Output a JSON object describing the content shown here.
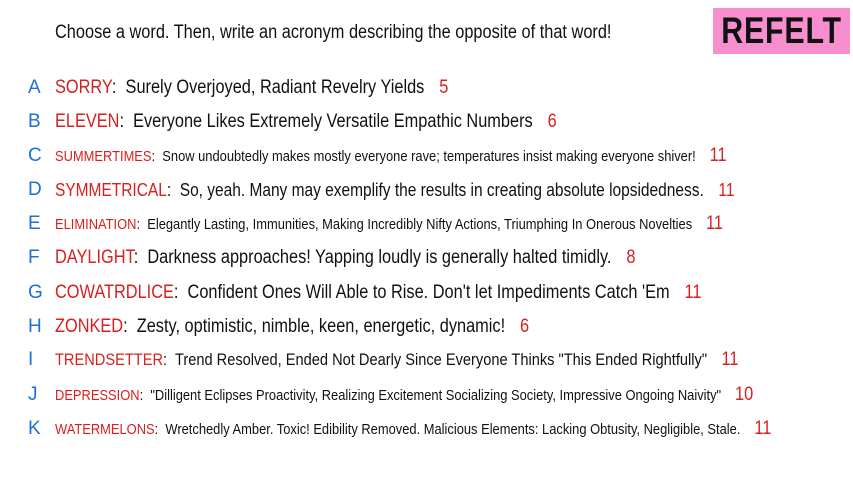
{
  "prompt": "Choose a word. Then, write an acronym describing the opposite of that word!",
  "brand": "REFELT",
  "colors": {
    "letter": "#1e6fd9",
    "word": "#d81e1e",
    "brand_bg": "#f78fcf"
  },
  "rows": [
    {
      "letter": "A",
      "word": "SORRY",
      "acronym": "Surely Overjoyed, Radiant Revelry Yields",
      "count": "5"
    },
    {
      "letter": "B",
      "word": "ELEVEN",
      "acronym": "Everyone Likes Extremely Versatile Empathic Numbers",
      "count": "6"
    },
    {
      "letter": "C",
      "word": "SUMMERTIMES",
      "acronym": "Snow undoubtedly makes mostly everyone rave; temperatures insist making everyone shiver!",
      "count": "11"
    },
    {
      "letter": "D",
      "word": "SYMMETRICAL",
      "acronym": "So, yeah. Many may exemplify the results in creating absolute lopsidedness.",
      "count": "11"
    },
    {
      "letter": "E",
      "word": "ELIMINATION",
      "acronym": "Elegantly Lasting, Immunities, Making Incredibly Nifty Actions, Triumphing In Onerous Novelties",
      "count": "11"
    },
    {
      "letter": "F",
      "word": "DAYLIGHT",
      "acronym": "Darkness approaches! Yapping loudly is generally halted timidly.",
      "count": "8"
    },
    {
      "letter": "G",
      "word": "COWATRDLICE",
      "acronym": "Confident Ones Will Able to Rise. Don't let Impediments Catch 'Em",
      "count": "11"
    },
    {
      "letter": "H",
      "word": "ZONKED",
      "acronym": "Zesty, optimistic, nimble, keen, energetic, dynamic!",
      "count": "6"
    },
    {
      "letter": "I",
      "word": "TRENDSETTER",
      "acronym": "Trend Resolved, Ended Not Dearly Since Everyone Thinks \"This Ended Rightfully\"",
      "count": "11"
    },
    {
      "letter": "J",
      "word": "DEPRESSION",
      "acronym": "\"Dilligent Eclipses Proactivity, Realizing Excitement Socializing Society, Impressive Ongoing Naivity\"",
      "count": "10"
    },
    {
      "letter": "K",
      "word": "WATERMELONS",
      "acronym": "Wretchedly Amber. Toxic! Edibility Removed. Malicious Elements: Lacking Obtusity, Negligible, Stale.",
      "count": "11"
    }
  ]
}
